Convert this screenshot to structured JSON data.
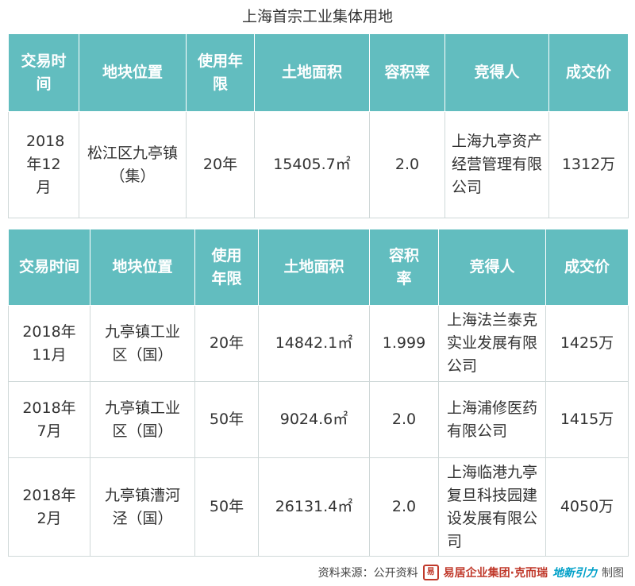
{
  "title": "上海首宗工业集体用地",
  "table1": {
    "headers": [
      "交易时间",
      "地块位置",
      "使用年限",
      "土地面积",
      "容积率",
      "竞得人",
      "成交价"
    ],
    "rows": [
      [
        "2018年12月",
        "松江区九亭镇（集）",
        "20年",
        "15405.7㎡",
        "2.0",
        "上海九亭资产经营管理有限公司",
        "1312万"
      ]
    ]
  },
  "table2": {
    "headers": [
      "交易时间",
      "地块位置",
      "使用年限",
      "土地面积",
      "容积率",
      "竞得人",
      "成交价"
    ],
    "rows": [
      [
        "2018年11月",
        "九亭镇工业区（国）",
        "20年",
        "14842.1㎡",
        "1.999",
        "上海法兰泰克实业发展有限公司",
        "1425万"
      ],
      [
        "2018年7月",
        "九亭镇工业区（国）",
        "50年",
        "9024.6㎡",
        "2.0",
        "上海浦修医药有限公司",
        "1415万"
      ],
      [
        "2018年2月",
        "九亭镇漕河泾（国）",
        "50年",
        "26131.4㎡",
        "2.0",
        "上海临港九亭复旦科技园建设发展有限公司",
        "4050万"
      ]
    ]
  },
  "footer": {
    "source": "资料来源：公开资料",
    "logo1_mark": "易",
    "logo1": "易居企业集团·克而瑞",
    "logo2": "地新引力",
    "suffix": "制图"
  }
}
